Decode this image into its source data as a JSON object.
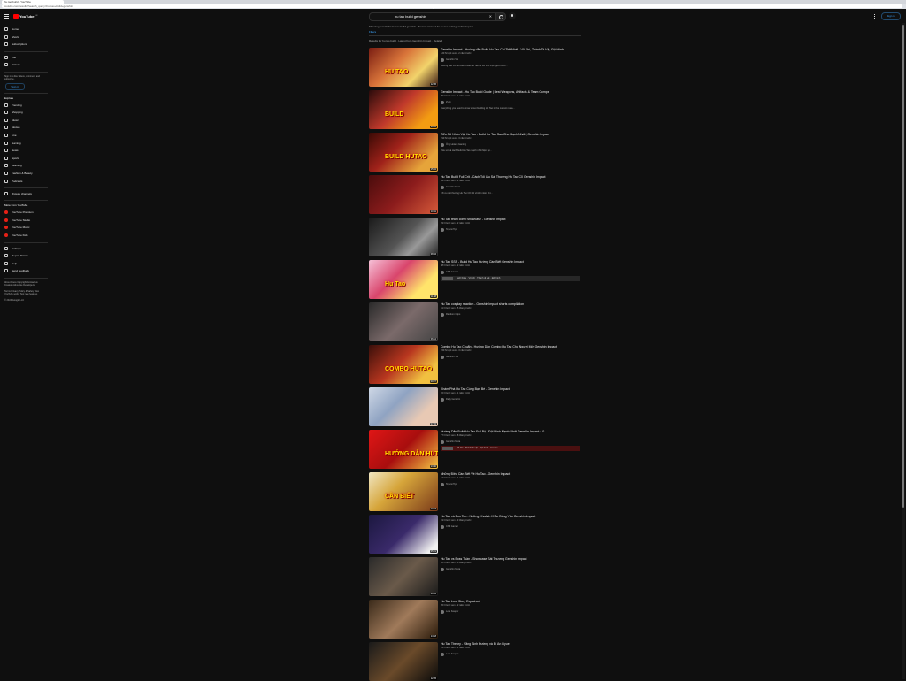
{
  "browser": {
    "tab_title": "hu tao build - YouTube",
    "url": "youtube.com/results?search_query=hu+tao+build+genshin"
  },
  "header": {
    "logo_text": "YouTube",
    "logo_region": "VN",
    "search_query": "hu tao build genshin",
    "search_placeholder": "Search",
    "sign_in": "Sign in"
  },
  "sidebar": {
    "top_items": [
      {
        "label": "Home",
        "icon": "home-icon"
      },
      {
        "label": "Shorts",
        "icon": "shorts-icon"
      },
      {
        "label": "Subscriptions",
        "icon": "subscriptions-icon"
      }
    ],
    "you_items": [
      {
        "label": "You",
        "icon": "you-icon"
      },
      {
        "label": "History",
        "icon": "history-icon"
      }
    ],
    "signin_note": "Sign in to like videos, comment, and subscribe.",
    "signin_button": "Sign in",
    "explore_header": "Explore",
    "explore_items": [
      {
        "label": "Trending",
        "icon": "trending-icon"
      },
      {
        "label": "Shopping",
        "icon": "shopping-icon"
      },
      {
        "label": "Music",
        "icon": "music-icon"
      },
      {
        "label": "Movies",
        "icon": "movies-icon"
      },
      {
        "label": "Live",
        "icon": "live-icon"
      },
      {
        "label": "Gaming",
        "icon": "gaming-icon"
      },
      {
        "label": "News",
        "icon": "news-icon"
      },
      {
        "label": "Sports",
        "icon": "sports-icon"
      },
      {
        "label": "Learning",
        "icon": "learning-icon"
      },
      {
        "label": "Fashion & Beauty",
        "icon": "fashion-icon"
      },
      {
        "label": "Podcasts",
        "icon": "podcasts-icon"
      }
    ],
    "browse_channels": "Browse channels",
    "more_header": "More from YouTube",
    "more_items": [
      {
        "label": "YouTube Premium"
      },
      {
        "label": "YouTube Studio"
      },
      {
        "label": "YouTube Music"
      },
      {
        "label": "YouTube Kids"
      }
    ],
    "settings_items": [
      {
        "label": "Settings",
        "icon": "gear-icon"
      },
      {
        "label": "Report history",
        "icon": "flag-icon"
      },
      {
        "label": "Help",
        "icon": "help-icon"
      },
      {
        "label": "Send feedback",
        "icon": "feedback-icon"
      }
    ],
    "footer_1": "About Press Copyright Contact us Creators Advertise Developers",
    "footer_2": "Terms Privacy Policy & Safety How YouTube works Test new features",
    "footer_3": "© 2024 Google LLC"
  },
  "main": {
    "scope_note": "Showing results for hu tao build genshin · Search instead for hu tao build genshin impact",
    "scope_link": "Filters",
    "filters_note": "Results for hu tao build · Latest from Genshin Impact · Related"
  },
  "videos": [
    {
      "title": "Genshin Impact - Hướng dẫn Build Hu Tao Chi Tiết Nhất - Vũ Khí, Thánh Di Vật, Đội Hình",
      "stats": "120 N lượt xem · 2 năm trước",
      "channel": "Genshin VN",
      "desc": "Hướng dẫn chi tiết cách build Hu Tao tối ưu cho mọi người chơi...",
      "dur": "12:45",
      "overlay": "HU TAO",
      "bg": "linear-gradient(135deg,#7a1d12,#d9753a 40%,#f2d36b 70%,#3b1a14)"
    },
    {
      "title": "Genshin Impact - Hu Tao Build Guide | Best Weapons, Artifacts & Team Comps",
      "stats": "85 N lượt xem · 1 năm trước",
      "channel": "Zy0x",
      "desc": "Everything you need to know about building Hu Tao in the current meta...",
      "dur": "18:20",
      "overlay": "BUILD",
      "bg": "linear-gradient(135deg,#2b0b0b,#c0392b 45%,#f39c12 80%)"
    },
    {
      "title": "Tiểu Sử Nhân Vật Hu Tao - Build Hu Tao Sao Cho Mạnh Nhất | Genshin Impact",
      "stats": "210 N lượt xem · 3 năm trước",
      "channel": "Ông Hoàng Gaming",
      "desc": "Tiểu sử và cách build Hu Tao mạnh nhất hiện tại...",
      "dur": "15:02",
      "overlay": "BUILD HUTAO",
      "bg": "linear-gradient(135deg,#3a0a05,#a0221a 40%,#e6a43a 80%)"
    },
    {
      "title": "Hu Tao Build Full Crit - Cách Tối Ưu Sát Thương Hu Tao C0 Genshin Impact",
      "stats": "64 N lượt xem · 1 năm trước",
      "channel": "Genshin Meta",
      "desc": "Tối ưu sát thương Hu Tao C0 với vũ khí miễn phí...",
      "dur": "10:11",
      "overlay": "",
      "bg": "linear-gradient(135deg,#4a0c0c,#8c1c1c 50%,#d65a3a)"
    },
    {
      "title": "Hu Tao team comp showcase - Genshin Impact",
      "stats": "33 N lượt xem · 2 năm trước",
      "channel": "Teyvat Tips",
      "desc": "",
      "dur": "08:34",
      "overlay": "",
      "bg": "linear-gradient(135deg,#1a1a1a,#555 50%,#999 70%,#222)"
    },
    {
      "title": "Hu Tao SSS - Build Hu Tao Hướng Cần Biết Genshin Impact",
      "stats": "98 N lượt xem · 2 năm trước",
      "channel": "Chill Gamer",
      "desc": "",
      "dur": "11:48",
      "overlay": "Hu Tao",
      "bg": "linear-gradient(135deg,#f6c1d8,#d9456c 40%,#ffe46b 75%)",
      "chapter": "Giới thiệu · Vũ khí · Thánh di vật · Đội hình"
    },
    {
      "title": "Hu Tao cosplay reaction - Genshin Impact shorts compilation",
      "stats": "41 N lượt xem · 5 tháng trước",
      "channel": "Random Clips",
      "desc": "",
      "dur": "06:12",
      "overlay": "",
      "bg": "linear-gradient(135deg,#2a2a2a,#7b6a6a 50%,#444)"
    },
    {
      "title": "Combo Hu Tao Chuẩn - Hướng Dẫn Combo Hu Tao Cho Người Mới Genshin Impact",
      "stats": "150 N lượt xem · 3 năm trước",
      "channel": "Genshin VN",
      "desc": "",
      "dur": "09:27",
      "overlay": "COMBO HUTAO",
      "bg": "linear-gradient(135deg,#3a0f0a,#b8361f 45%,#f1c040 80%)"
    },
    {
      "title": "Khám Phá Hu Tao Cùng Bạn Bè - Genshin Impact",
      "stats": "22 N lượt xem · 1 năm trước",
      "channel": "Daily Genshin",
      "desc": "",
      "dur": "07:55",
      "overlay": "",
      "bg": "linear-gradient(135deg,#cfd8e6,#8fa3c2 40%,#e8c9b4 75%)"
    },
    {
      "title": "Hướng Dẫn Build Hu Tao Full Bộ - Đội Hình Mạnh Nhất Genshin Impact 4.0",
      "stats": "77 N lượt xem · 8 tháng trước",
      "channel": "Genshin Meta",
      "desc": "",
      "dur": "13:40",
      "overlay": "HƯỚNG DẪN HUTAO",
      "bg": "linear-gradient(135deg,#e01616,#a80e0e 50%,#f4c542)",
      "chapter": "Vũ khí · Thánh di vật · Đội hình · Combo",
      "chapter_red": true
    },
    {
      "title": "Những Điều Cần Biết Về Hu Tao - Genshin Impact",
      "stats": "54 N lượt xem · 1 năm trước",
      "channel": "Teyvat Tips",
      "desc": "",
      "dur": "10:03",
      "overlay": "CẦN BIẾT",
      "bg": "linear-gradient(135deg,#f0e6c2,#d6a53a 40%,#7a3a1a)"
    },
    {
      "title": "Hu Tao và Boo Tao - Những Khoảnh Khắc Đáng Yêu Genshin Impact",
      "stats": "19 N lượt xem · 3 tháng trước",
      "channel": "Chill Gamer",
      "desc": "",
      "dur": "05:21",
      "overlay": "",
      "bg": "linear-gradient(135deg,#1c1840,#3a2a6a 50%,#f1f1f1 90%)"
    },
    {
      "title": "Hu Tao vs Boss Tuần - Showcase Sát Thương Genshin Impact",
      "stats": "28 N lượt xem · 6 tháng trước",
      "channel": "Genshin Meta",
      "desc": "",
      "dur": "08:02",
      "overlay": "",
      "bg": "linear-gradient(135deg,#2a2a2a,#6a5a4a 50%,#1a1a1a)"
    },
    {
      "title": "Hu Tao Lore Story Explained",
      "stats": "45 N lượt xem · 2 năm trước",
      "channel": "Lore Keeper",
      "desc": "",
      "dur": "14:18",
      "overlay": "",
      "bg": "linear-gradient(135deg,#3a2a1a,#a07a5a 50%,#2a1a0a)"
    },
    {
      "title": "Hu Tao Theory - Vãng Sinh Đường và Bí Ẩn Liyue",
      "stats": "31 N lượt xem · 1 năm trước",
      "channel": "Lore Keeper",
      "desc": "",
      "dur": "12:05",
      "overlay": "",
      "bg": "linear-gradient(135deg,#1a1a1a,#6a4a2a 50%,#0a0a0a)"
    }
  ],
  "colors": {
    "accent_blue": "#3ea6ff",
    "brand_red": "#ff0000",
    "bg": "#0f0f0f"
  }
}
